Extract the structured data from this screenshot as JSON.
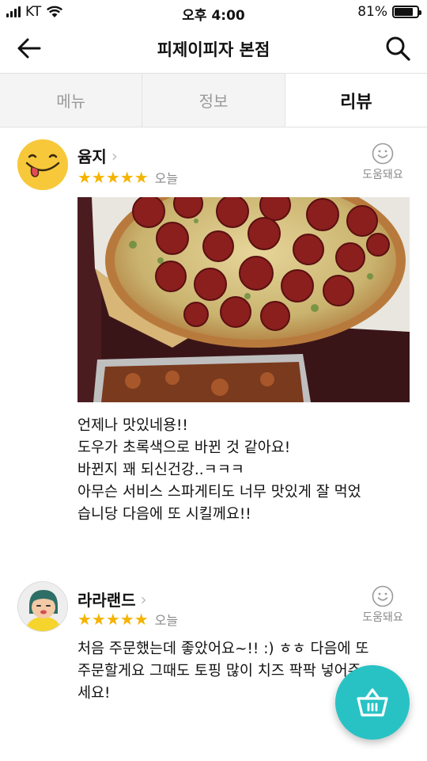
{
  "status": {
    "carrier": "KT",
    "time": "오후 4:00",
    "battery": "81%",
    "battery_level": 0.81
  },
  "header": {
    "title": "피제이피자 본점"
  },
  "tabs": [
    {
      "label": "메뉴"
    },
    {
      "label": "정보"
    },
    {
      "label": "리뷰"
    }
  ],
  "reviews": [
    {
      "author": "윰지",
      "rating": 5,
      "stars": "★★★★★",
      "date": "오늘",
      "helpful": "도움돼요",
      "text": "언제나 맛있네용!!\n도우가 초록색으로 바뀐 것 같아요!\n바뀐지 꽤 되신건강..ㅋㅋㅋ\n아무슨 서비스 스파게티도 너무 맛있게 잘 먹었\n습니당 다음에 또 시킬께요!!"
    },
    {
      "author": "라라랜드",
      "rating": 5,
      "stars": "★★★★★",
      "date": "오늘",
      "helpful": "도움돼요",
      "text": "처음 주문했는데 좋았어요~!! :) ㅎㅎ 다음에 또\n주문할게요 그때도 토핑 많이 치즈 팍팍 넣어주\n세요!"
    }
  ],
  "colors": {
    "star": "#f4b400",
    "fab": "#28c2c4"
  }
}
